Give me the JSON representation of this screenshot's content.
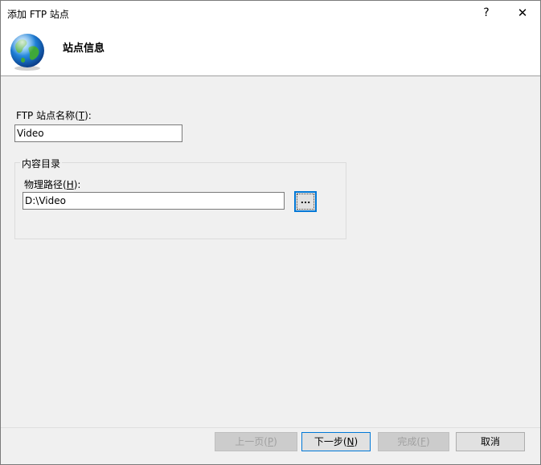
{
  "window": {
    "title": "添加 FTP 站点",
    "help_glyph": "?",
    "close_glyph": "✕"
  },
  "header": {
    "title": "站点信息",
    "icon": "globe-icon"
  },
  "site_name": {
    "label_prefix": "FTP 站点名称(",
    "label_key": "T",
    "label_suffix": "):",
    "value": "Video"
  },
  "content_directory": {
    "legend": "内容目录",
    "path_label_prefix": "物理路径(",
    "path_label_key": "H",
    "path_label_suffix": "):",
    "path_value": "D:\\Video",
    "browse_label": "..."
  },
  "footer": {
    "prev_prefix": "上一页(",
    "prev_key": "P",
    "prev_suffix": ")",
    "next_prefix": "下一步(",
    "next_key": "N",
    "next_suffix": ")",
    "finish_prefix": "完成(",
    "finish_key": "F",
    "finish_suffix": ")",
    "cancel": "取消"
  },
  "colors": {
    "accent": "#0078d7",
    "dialog_bg": "#f0f0f0",
    "header_bg": "#ffffff"
  }
}
